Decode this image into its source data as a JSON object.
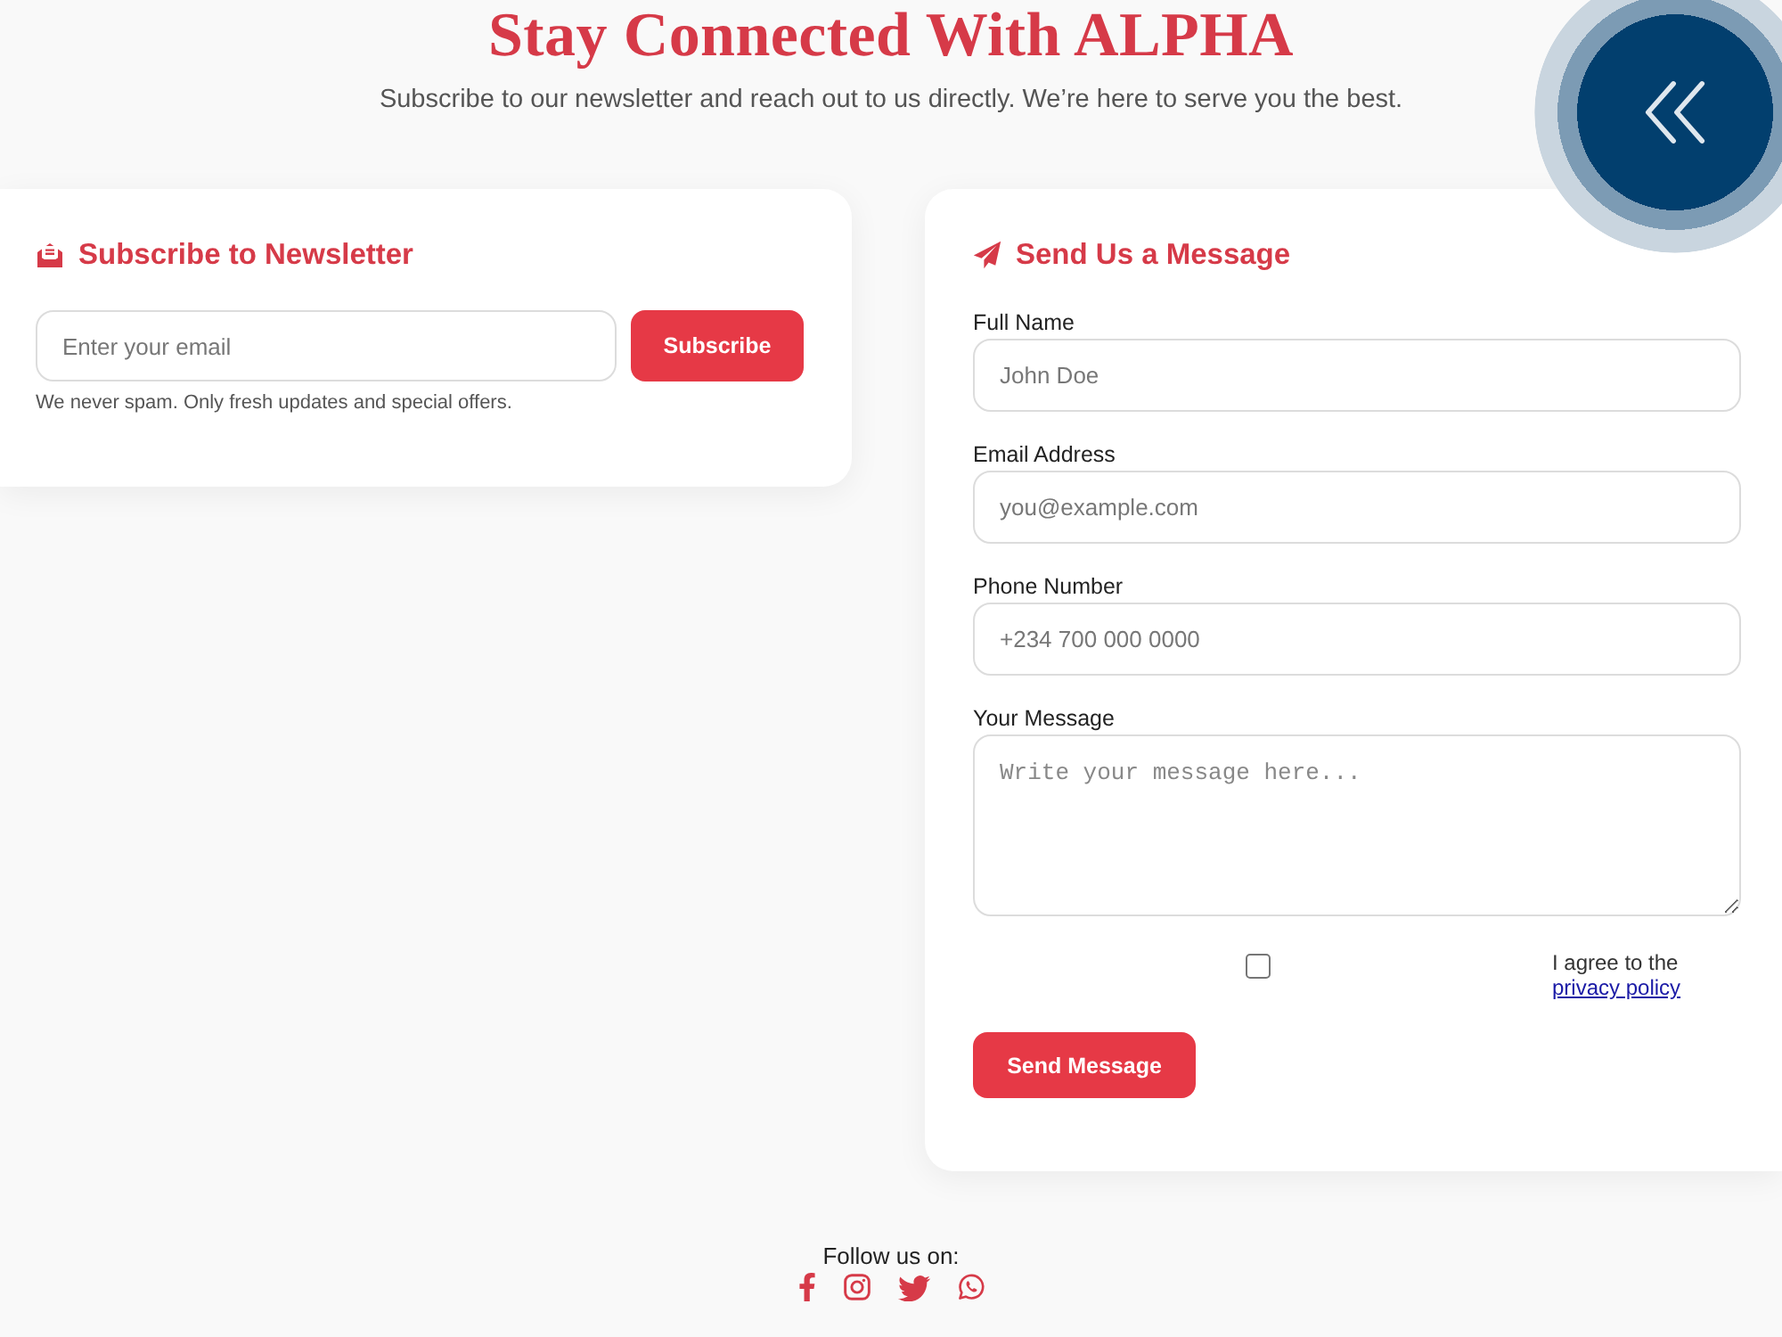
{
  "header": {
    "title": "Stay Connected With ALPHA",
    "subtitle": "Subscribe to our newsletter and reach out to us directly. We’re here to serve you the best."
  },
  "newsletter": {
    "heading": "Subscribe to Newsletter",
    "email": {
      "placeholder": "Enter your email"
    },
    "button": "Subscribe",
    "note": "We never spam. Only fresh updates and special offers."
  },
  "contact": {
    "heading": "Send Us a Message",
    "fields": [
      {
        "kind": "input",
        "label": "Full Name",
        "placeholder": "John Doe"
      },
      {
        "kind": "input",
        "label": "Email Address",
        "placeholder": "you@example.com"
      },
      {
        "kind": "input",
        "label": "Phone Number",
        "placeholder": "+234 700 000 0000"
      },
      {
        "kind": "textarea",
        "label": "Your Message",
        "placeholder": "Write your message here..."
      }
    ],
    "agreement": {
      "checked": false,
      "text": "I agree to the",
      "link": "privacy policy"
    },
    "button": "Send Message"
  },
  "footer": {
    "label": "Follow us on:",
    "social": [
      {
        "kind": "facebook"
      },
      {
        "kind": "instagram"
      },
      {
        "kind": "twitter"
      },
      {
        "kind": "whatsapp"
      }
    ]
  }
}
